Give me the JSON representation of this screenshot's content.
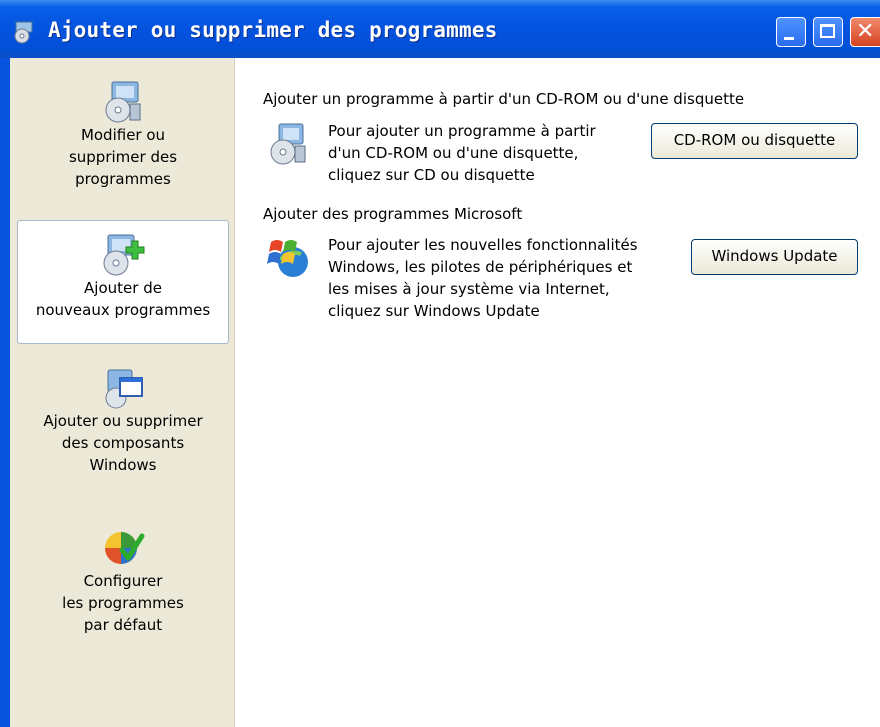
{
  "window": {
    "title": "Ajouter ou supprimer des programmes",
    "icon": "add-remove-programs-icon"
  },
  "titlebar_buttons": {
    "minimize": "minimize-icon",
    "maximize": "maximize-icon",
    "close": "close-icon"
  },
  "sidebar": {
    "items": [
      {
        "label": "Modifier ou\nsupprimer des\nprogrammes",
        "icon": "change-remove-programs-icon",
        "selected": false
      },
      {
        "label": "Ajouter de\nnouveaux programmes",
        "icon": "add-new-programs-icon",
        "selected": true
      },
      {
        "label": "Ajouter ou supprimer\ndes composants\nWindows",
        "icon": "windows-components-icon",
        "selected": false
      },
      {
        "label": "Configurer\nles programmes\npar défaut",
        "icon": "default-programs-icon",
        "selected": false
      }
    ]
  },
  "main": {
    "sections": [
      {
        "title": "Ajouter un programme à partir d'un CD-ROM ou d'une disquette",
        "description": "Pour ajouter un programme à partir\nd'un CD-ROM ou d'une disquette,\ncliquez sur CD ou disquette",
        "button": "CD-ROM ou disquette",
        "icon": "cd-installer-icon"
      },
      {
        "title": "Ajouter des programmes Microsoft",
        "description": "Pour ajouter les nouvelles fonctionnalités\nWindows, les pilotes de périphériques et\nles mises à jour système via Internet,\ncliquez sur Windows Update",
        "button": "Windows Update",
        "icon": "windows-update-icon"
      }
    ]
  },
  "colors": {
    "titlebar": "#0454e0",
    "sidebar_bg": "#ece9d8",
    "close_button": "#d5431f"
  }
}
